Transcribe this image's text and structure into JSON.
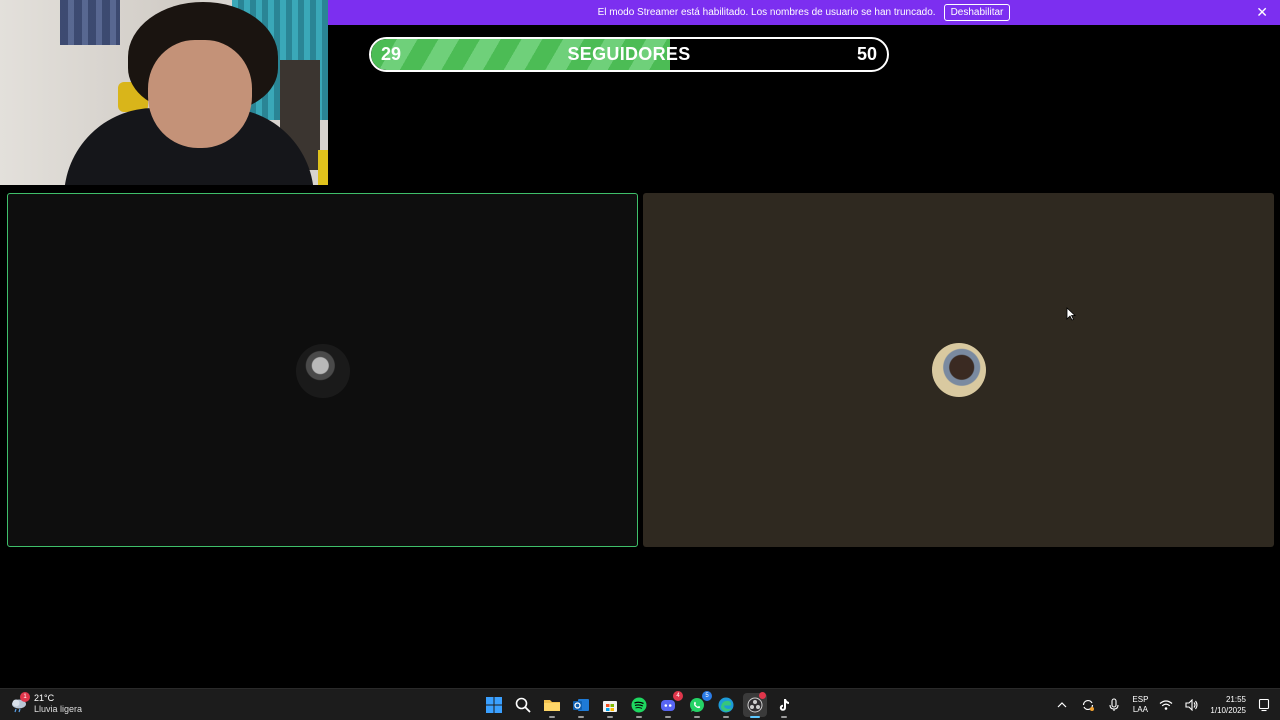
{
  "banner": {
    "message": "El modo Streamer está habilitado. Los nombres de usuario se han truncado.",
    "disable_label": "Deshabilitar",
    "close_icon": "close-icon",
    "color": "#7c2ff0"
  },
  "goal": {
    "current": "29",
    "label": "SEGUIDORES",
    "target": "50",
    "progress_fraction": 0.58,
    "fill_color": "#4cbc55"
  },
  "tiles": {
    "left": {
      "speaking": true,
      "border_color": "#3fbf6a",
      "avatar_icon": "user-avatar"
    },
    "right": {
      "speaking": false,
      "background": "#2f2920",
      "avatar_icon": "user-avatar"
    }
  },
  "taskbar": {
    "weather": {
      "temp": "21°C",
      "condition": "Lluvia ligera",
      "alert_badge": "1"
    },
    "apps": [
      {
        "name": "start",
        "icon": "windows-icon"
      },
      {
        "name": "search",
        "icon": "search-icon"
      },
      {
        "name": "file-explorer",
        "icon": "folder-icon"
      },
      {
        "name": "outlook",
        "icon": "outlook-icon"
      },
      {
        "name": "store",
        "icon": "store-icon"
      },
      {
        "name": "spotify",
        "icon": "spotify-icon"
      },
      {
        "name": "discord",
        "icon": "discord-icon",
        "badge": "4"
      },
      {
        "name": "whatsapp",
        "icon": "whatsapp-icon",
        "badge": "5"
      },
      {
        "name": "edge",
        "icon": "edge-icon"
      },
      {
        "name": "obs",
        "icon": "obs-icon",
        "active": true
      },
      {
        "name": "tiktok",
        "icon": "tiktok-icon"
      }
    ],
    "tray": {
      "lang_top": "ESP",
      "lang_bottom": "LAA",
      "time": "21:55",
      "date": "1/10/2025"
    }
  }
}
